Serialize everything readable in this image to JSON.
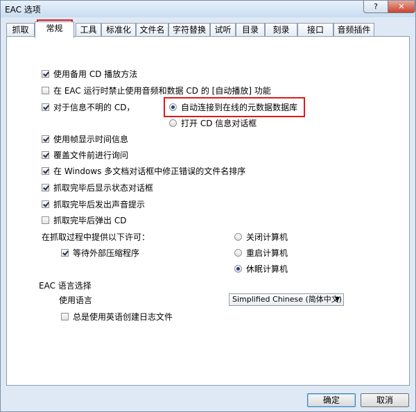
{
  "window": {
    "title": "EAC 选项",
    "help": "?",
    "close": "✕"
  },
  "tabs": [
    "抓取",
    "常规",
    "工具",
    "标准化",
    "文件名",
    "字符替换",
    "试听",
    "目录",
    "刻录",
    "接口",
    "音频插件"
  ],
  "active_tab_index": 1,
  "options": {
    "use_alt_cd_playback": {
      "label": "使用备用 CD 播放方法",
      "checked": true
    },
    "disable_autoplay": {
      "label": "在 EAC 运行时禁止使用音频和数据 CD 的 [自动播放] 功能",
      "checked": false
    },
    "unknown_cd": {
      "label": "对于信息不明的 CD，",
      "checked": true
    },
    "unknown_cd_radio_1": {
      "label": "自动连接到在线的元数据数据库",
      "checked": true
    },
    "unknown_cd_radio_2": {
      "label": "打开 CD 信息对话框",
      "checked": false
    },
    "show_frames": {
      "label": "使用帧显示时间信息",
      "checked": true
    },
    "ask_overwrite": {
      "label": "覆盖文件前进行询问",
      "checked": true
    },
    "fix_sort": {
      "label": "在 Windows 多文档对话框中修正错误的文件名排序",
      "checked": true
    },
    "show_status": {
      "label": "抓取完毕后显示状态对话框",
      "checked": true
    },
    "beep": {
      "label": "抓取完毕后发出声音提示",
      "checked": true
    },
    "eject": {
      "label": "抓取完毕后弹出 CD",
      "checked": false
    }
  },
  "ripping": {
    "heading": "在抓取过程中提供以下许可：",
    "wait_compressor": {
      "label": "等待外部压缩程序",
      "checked": true
    },
    "power_options": [
      {
        "label": "关闭计算机",
        "checked": false
      },
      {
        "label": "重启计算机",
        "checked": false
      },
      {
        "label": "休眠计算机",
        "checked": true
      }
    ]
  },
  "language": {
    "heading": "EAC 语言选择",
    "use_label": "使用语言",
    "selected": "Simplified Chinese (简体中文)",
    "english_log": {
      "label": "总是使用英语创建日志文件",
      "checked": false
    }
  },
  "buttons": {
    "ok": "确定",
    "cancel": "取消"
  },
  "colors": {
    "highlight_border": "#e01818"
  }
}
